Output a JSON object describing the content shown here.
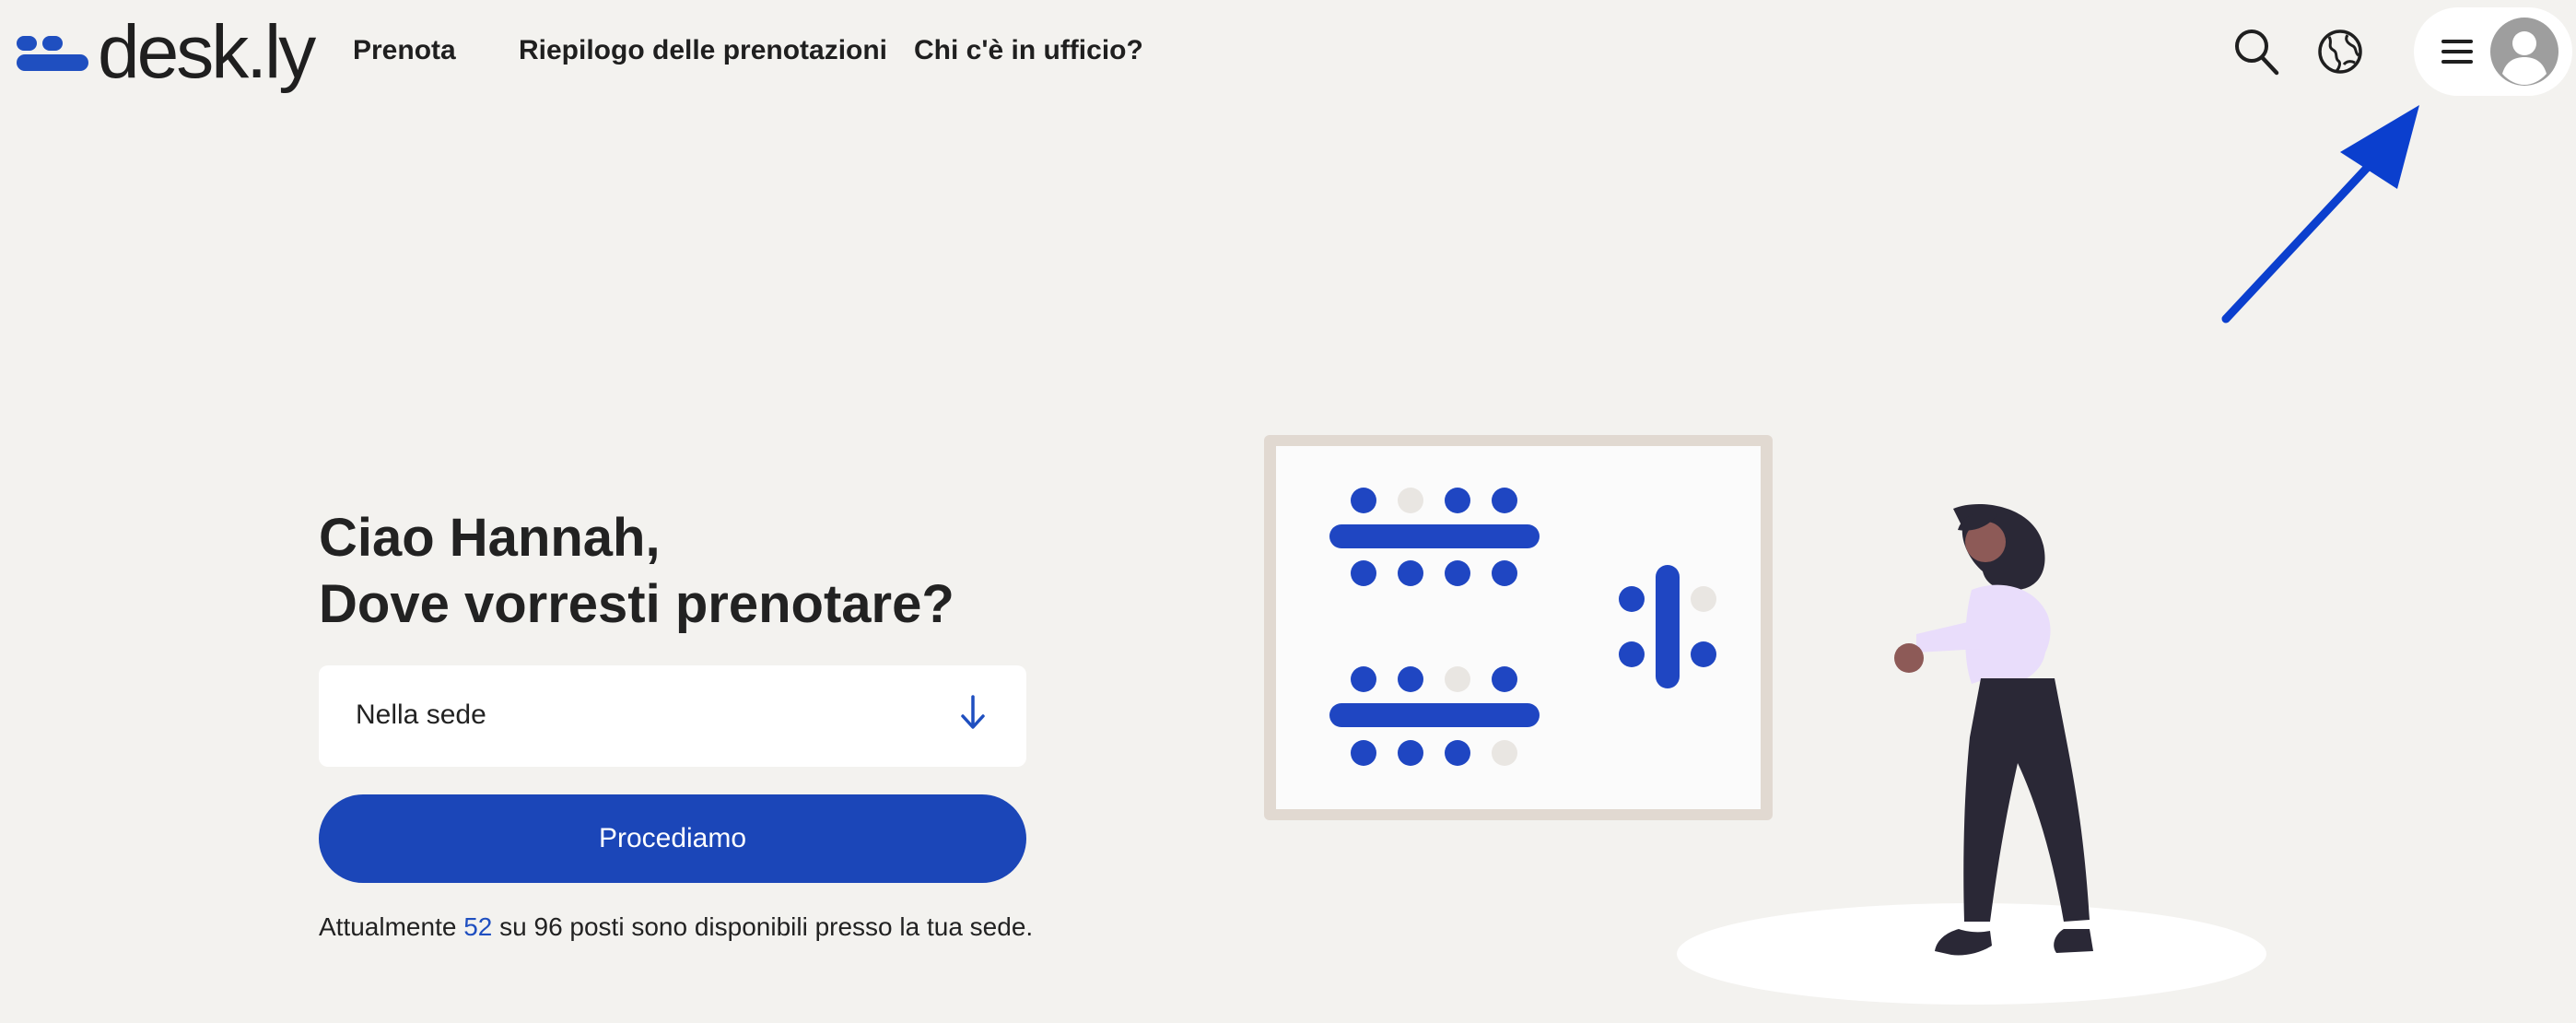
{
  "brand": {
    "name": "desk.ly",
    "color": "#1f4fc0"
  },
  "nav": {
    "items": [
      {
        "label": "Prenota"
      },
      {
        "label": "Riepilogo delle prenotazioni"
      },
      {
        "label": "Chi c'è in ufficio?"
      }
    ]
  },
  "header_icons": [
    "search-icon",
    "globe-icon",
    "menu-icon",
    "user-avatar-icon"
  ],
  "hero": {
    "greeting_line1": "Ciao Hannah,",
    "greeting_line2": "Dove vorresti prenotare?",
    "location_select": {
      "value": "Nella sede",
      "icon": "arrow-down-icon"
    },
    "proceed_label": "Procediamo",
    "availability": {
      "prefix": "Attualmente ",
      "available": "52",
      "middle": " su 96 posti sono disponibili presso la tua sede."
    }
  },
  "colors": {
    "accent": "#1b46b8",
    "background": "#f3f2ef",
    "annotation_arrow": "#0b3fce"
  }
}
